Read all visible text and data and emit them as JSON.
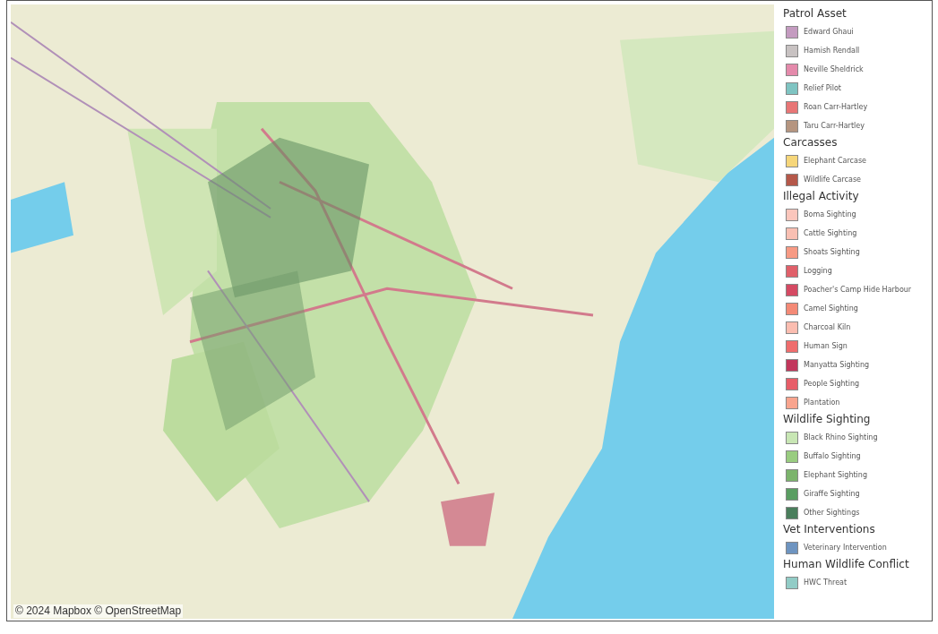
{
  "map": {
    "attribution": "© 2024 Mapbox © OpenStreetMap"
  },
  "legend": [
    {
      "title": "Patrol Asset",
      "items": [
        {
          "label": "Edward Ghaui",
          "color": "#c49bc0"
        },
        {
          "label": "Hamish Rendall",
          "color": "#c8c2c2"
        },
        {
          "label": "Neville Sheldrick",
          "color": "#e48aab"
        },
        {
          "label": "Relief Pilot",
          "color": "#7fc4c2"
        },
        {
          "label": "Roan Carr-Hartley",
          "color": "#e87676"
        },
        {
          "label": "Taru Carr-Hartley",
          "color": "#b59580"
        }
      ]
    },
    {
      "title": "Carcasses",
      "items": [
        {
          "label": "Elephant Carcase",
          "color": "#f6d67a"
        },
        {
          "label": "Wildlife Carcase",
          "color": "#b5584a"
        }
      ]
    },
    {
      "title": "Illegal Activity",
      "items": [
        {
          "label": "Boma Sighting",
          "color": "#fbc6bc"
        },
        {
          "label": "Cattle Sighting",
          "color": "#f9bfb2"
        },
        {
          "label": "Shoats Sighting",
          "color": "#f79a84"
        },
        {
          "label": "Logging",
          "color": "#e0606a"
        },
        {
          "label": "Poacher's Camp Hide Harbour",
          "color": "#d54a63"
        },
        {
          "label": "Camel Sighting",
          "color": "#f48a76"
        },
        {
          "label": "Charcoal Kiln",
          "color": "#fbbdb0"
        },
        {
          "label": "Human Sign",
          "color": "#ef6d6d"
        },
        {
          "label": "Manyatta Sighting",
          "color": "#c2375c"
        },
        {
          "label": "People Sighting",
          "color": "#e75d68"
        },
        {
          "label": "Plantation",
          "color": "#f8a48e"
        }
      ]
    },
    {
      "title": "Wildlife Sighting",
      "items": [
        {
          "label": "Black Rhino Sighting",
          "color": "#c8e6b4"
        },
        {
          "label": "Buffalo Sighting",
          "color": "#99cc80"
        },
        {
          "label": "Elephant Sighting",
          "color": "#7cb46c"
        },
        {
          "label": "Giraffe Sighting",
          "color": "#5a9e62"
        },
        {
          "label": "Other Sightings",
          "color": "#4a7e5c"
        }
      ]
    },
    {
      "title": "Vet Interventions",
      "items": [
        {
          "label": "Veterinary Intervention",
          "color": "#6e94c0"
        }
      ]
    },
    {
      "title": "Human Wildlife Conflict",
      "items": [
        {
          "label": "HWC Threat",
          "color": "#92ccc6"
        }
      ]
    }
  ]
}
